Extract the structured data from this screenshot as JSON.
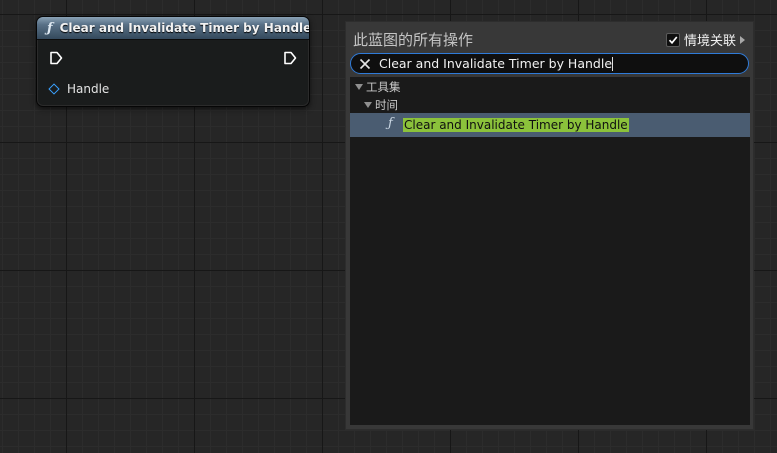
{
  "node": {
    "title": "Clear and Invalidate Timer by Handle",
    "function_icon": "ƒ",
    "pins": [
      {
        "name": "Handle",
        "type": "struct-input"
      }
    ]
  },
  "action_menu": {
    "title": "此蓝图的所有操作",
    "context_sensitive": {
      "label": "情境关联",
      "checked": true
    },
    "search": {
      "value": "Clear and Invalidate Timer by Handle"
    },
    "tree": {
      "category": "工具集",
      "subcategory": "时间",
      "function_icon": "ƒ",
      "items": [
        {
          "label": "Clear and Invalidate Timer by Handle",
          "selected": true
        }
      ]
    }
  },
  "colors": {
    "graph_background": "#262626",
    "node_header": "#587086",
    "pin_struct": "#39a0ff",
    "search_focus": "#2f7bd9",
    "selected_row": "#4a5c71",
    "match_highlight": "#8bc23b"
  },
  "icons": [
    "exec-in-pin-icon",
    "exec-out-pin-icon",
    "struct-pin-icon",
    "function-icon",
    "checkbox-check-icon",
    "expand-arrow-icon",
    "clear-search-icon",
    "tree-collapse-icon"
  ]
}
